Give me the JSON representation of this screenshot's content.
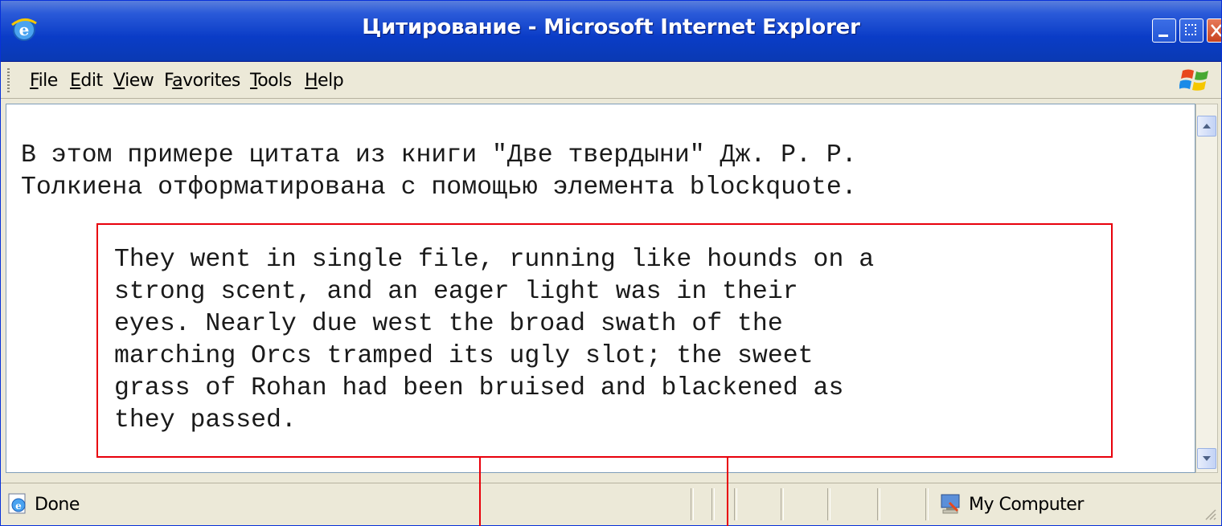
{
  "window": {
    "title": "Цитирование - Microsoft Internet Explorer"
  },
  "menu": {
    "items": [
      {
        "accel": "F",
        "rest": "ile"
      },
      {
        "accel": "E",
        "rest": "dit"
      },
      {
        "accel": "V",
        "rest": "iew"
      },
      {
        "pre": "F",
        "accel": "a",
        "rest": "vorites"
      },
      {
        "accel": "T",
        "rest": "ools"
      },
      {
        "accel": "H",
        "rest": "elp"
      }
    ]
  },
  "content": {
    "intro": "В этом примере цитата из книги \"Две твердыни\" Дж. Р. Р.\nТолкиена отформатирована с помощью элемента blockquote.",
    "blockquote": "They went in single file, running like hounds on a\nstrong scent, and an eager light was in their\neyes. Nearly due west the broad swath of the\nmarching Orcs tramped its ugly slot; the sweet\ngrass of Rohan had been bruised and blackened as\nthey passed."
  },
  "status": {
    "text": "Done",
    "zone": "My Computer"
  },
  "icons": {
    "title": "ie-icon",
    "status": "page-done-icon",
    "zone": "my-computer-icon",
    "brand": "windows-logo-icon"
  },
  "colors": {
    "titlebar": "#0a3cc7",
    "annotation": "#e8000b"
  }
}
